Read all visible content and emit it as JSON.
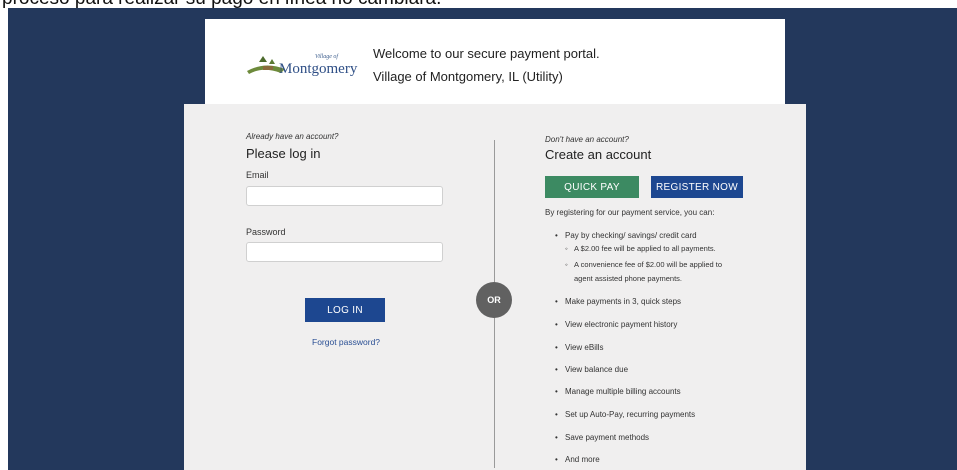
{
  "banner": {
    "text": "proceso para realizar su pago en línea no cambiará."
  },
  "header": {
    "welcome": "Welcome to our secure payment portal.",
    "organization": "Village of Montgomery, IL (Utility)",
    "logo_small": "Village of",
    "logo_main": "Montgomery"
  },
  "login": {
    "prompt": "Already have an account?",
    "title": "Please log in",
    "email_label": "Email",
    "email_value": "",
    "password_label": "Password",
    "password_value": "",
    "login_button": "LOG IN",
    "forgot_link": "Forgot password?"
  },
  "separator": {
    "or_label": "OR"
  },
  "register": {
    "prompt": "Don't have an account?",
    "title": "Create an account",
    "quick_pay_button": "QUICK PAY",
    "register_button": "REGISTER NOW",
    "intro": "By registering for our payment service, you can:",
    "payment_methods": "Pay by checking/ savings/ credit card",
    "fee_note": "A $2.00 fee will be applied to all payments.",
    "phone_fee_line1": "A convenience fee of $2.00 will be applied to",
    "phone_fee_line2": "agent assisted phone payments.",
    "benefits": [
      "Make payments in 3, quick steps",
      "View electronic payment history",
      "View eBills",
      "View balance due",
      "Manage multiple billing accounts",
      "Set up Auto-Pay, recurring payments",
      "Save payment methods",
      "And more"
    ]
  },
  "colors": {
    "navy_background": "#23385c",
    "primary_button": "#1d4790",
    "quick_pay_button": "#3c8a62",
    "or_circle": "#616161"
  }
}
